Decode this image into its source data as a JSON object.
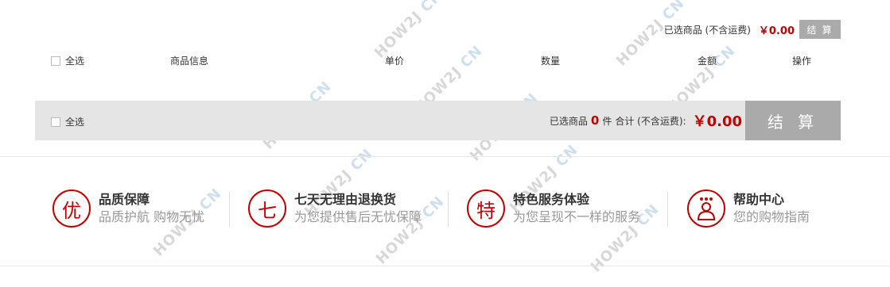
{
  "cart": {
    "top_summary": {
      "label": "已选商品 (不含运费)",
      "price": "￥0.00",
      "button": "结 算"
    },
    "headers": {
      "select_all": "全选",
      "info": "商品信息",
      "price": "单价",
      "qty": "数量",
      "amount": "金额",
      "op": "操作"
    },
    "bottom": {
      "select_all": "全选",
      "selected_label": "已选商品",
      "count": "0",
      "count_unit": "件",
      "total_label": "合计 (不含运费):",
      "total": "￥0.00",
      "button": "结 算"
    }
  },
  "services": [
    {
      "glyph": "优",
      "title": "品质保障",
      "sub": "品质护航 购物无忧",
      "icon": "quality-icon"
    },
    {
      "glyph": "七",
      "title": "七天无理由退换货",
      "sub": "为您提供售后无忧保障",
      "icon": "seven-day-return-icon"
    },
    {
      "glyph": "特",
      "title": "特色服务体验",
      "sub": "为您呈现不一样的服务",
      "icon": "special-service-icon"
    },
    {
      "glyph": "",
      "title": "帮助中心",
      "sub": "您的购物指南",
      "icon": "help-center-icon"
    }
  ],
  "watermark": {
    "text": "HOW2J",
    "suffix": "CN"
  },
  "colors": {
    "accent": "#c40000",
    "button_gray": "#aaaaaa",
    "bar_bg": "#e5e5e5"
  }
}
